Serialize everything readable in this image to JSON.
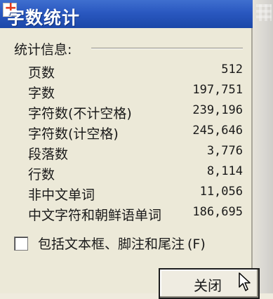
{
  "dialog": {
    "title": "字数统计",
    "section_label": "统计信息:",
    "stats": [
      {
        "label": "页数",
        "value": "512"
      },
      {
        "label": "字数",
        "value": "197,751"
      },
      {
        "label": "字符数(不计空格)",
        "value": "239,196"
      },
      {
        "label": "字符数(计空格)",
        "value": "245,646"
      },
      {
        "label": "段落数",
        "value": "3,776"
      },
      {
        "label": "行数",
        "value": "8,114"
      },
      {
        "label": "非中文单词",
        "value": "11,056"
      },
      {
        "label": "中文字符和朝鲜语单词",
        "value": "186,695"
      }
    ],
    "checkbox": {
      "label": "包括文本框、脚注和尾注",
      "hotkey": "(F)",
      "checked": false
    },
    "close_label": "关闭"
  },
  "icons": {
    "title": "app-icon",
    "cursor": "mouse-pointer-icon"
  }
}
